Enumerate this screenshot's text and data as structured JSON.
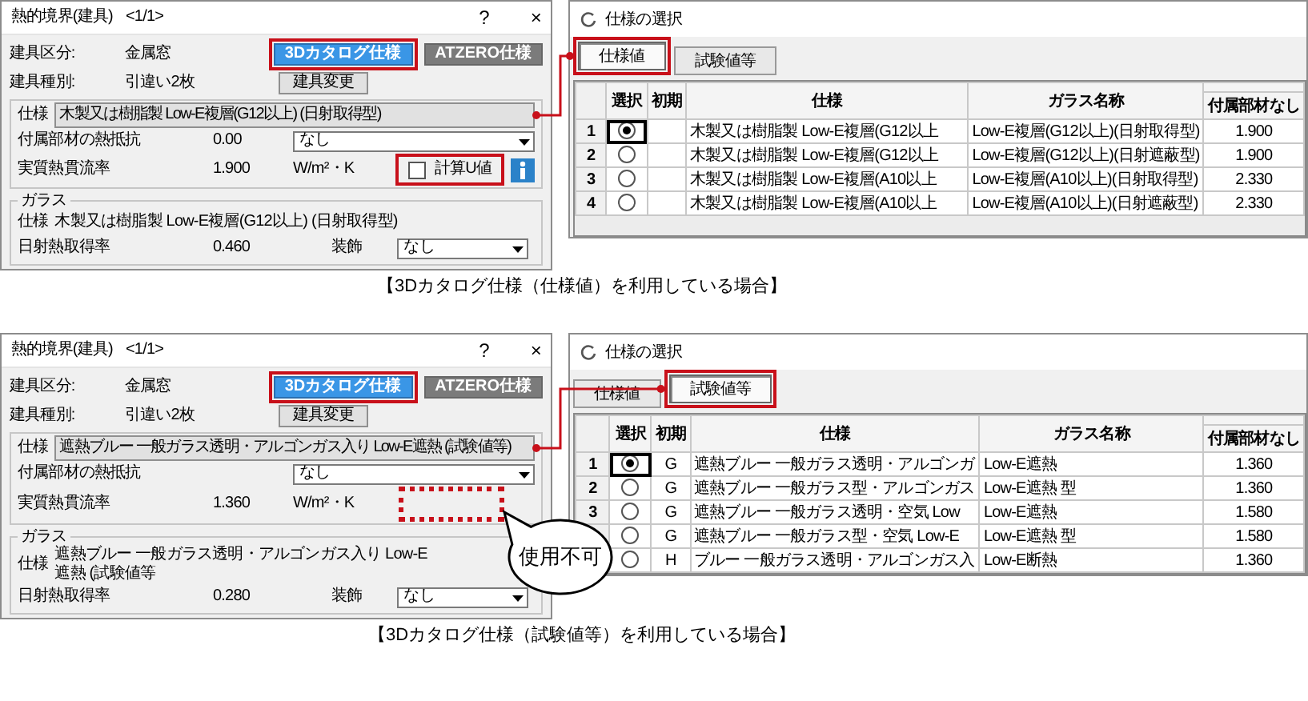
{
  "panels": [
    {
      "spec_dialog": {
        "title": "熱的境界(建具)",
        "page": "<1/1>",
        "help_button": "?",
        "close_button": "×",
        "class_label": "建具区分:",
        "class_value": "金属窓",
        "type_label": "建具種別:",
        "type_value": "引違い2枚",
        "mode_buttons": [
          {
            "label": "3Dカタログ仕様",
            "selected": true,
            "highlighted": true
          },
          {
            "label": "ATZERO仕様",
            "selected": false,
            "highlighted": false
          }
        ],
        "change_button": "建具変更",
        "spec_label": "仕様",
        "spec_value": "木製又は樹脂製 Low-E複層(G12以上) (日射取得型)",
        "resistance_label": "付属部材の熱抵抗",
        "resistance_value": "0.00",
        "resistance_select": "なし",
        "u_label": "実質熱貫流率",
        "u_value": "1.900",
        "u_unit": "W/m²・K",
        "calc_u": {
          "kind": "checkbox",
          "label": "計算U値",
          "checked": false,
          "highlighted": true
        },
        "info_button": true,
        "glass_group": "ガラス",
        "glass_spec_label": "仕様",
        "glass_spec_value": "木製又は樹脂製 Low-E複層(G12以上) (日射取得型)",
        "solar_label": "日射熱取得率",
        "solar_value": "0.460",
        "decoration_label": "装飾",
        "decoration_select": "なし"
      },
      "selection_dialog": {
        "title": "仕様の選択",
        "tabs": [
          {
            "label": "仕様値",
            "selected": true,
            "highlighted": true
          },
          {
            "label": "試験値等",
            "selected": false,
            "highlighted": false
          }
        ],
        "columns": [
          "選択",
          "初期",
          "仕様",
          "ガラス名称",
          "付属部材なし"
        ],
        "rows": [
          {
            "number": "1",
            "selected": true,
            "spec": "木製又は樹脂製 Low-E複層(G12以上",
            "glass": "Low-E複層(G12以上)(日射取得型)",
            "value": "1.900"
          },
          {
            "number": "2",
            "selected": false,
            "spec": "木製又は樹脂製 Low-E複層(G12以上",
            "glass": "Low-E複層(G12以上)(日射遮蔽型)",
            "value": "1.900"
          },
          {
            "number": "3",
            "selected": false,
            "spec": "木製又は樹脂製 Low-E複層(A10以上",
            "glass": "Low-E複層(A10以上)(日射取得型)",
            "value": "2.330"
          },
          {
            "number": "4",
            "selected": false,
            "spec": "木製又は樹脂製 Low-E複層(A10以上",
            "glass": "Low-E複層(A10以上)(日射遮蔽型)",
            "value": "2.330"
          }
        ]
      },
      "caption": "【3Dカタログ仕様（仕様値）を利用している場合】"
    },
    {
      "spec_dialog": {
        "title": "熱的境界(建具)",
        "page": "<1/1>",
        "help_button": "?",
        "close_button": "×",
        "class_label": "建具区分:",
        "class_value": "金属窓",
        "type_label": "建具種別:",
        "type_value": "引違い2枚",
        "mode_buttons": [
          {
            "label": "3Dカタログ仕様",
            "selected": true,
            "highlighted": true
          },
          {
            "label": "ATZERO仕様",
            "selected": false,
            "highlighted": false
          }
        ],
        "change_button": "建具変更",
        "spec_label": "仕様",
        "spec_value": "遮熱ブルー 一般ガラス透明・アルゴンガス入り Low-E遮熱 (試験値等)",
        "resistance_label": "付属部材の熱抵抗",
        "resistance_select": "なし",
        "u_label": "実質熱貫流率",
        "u_value": "1.360",
        "u_unit": "W/m²・K",
        "calc_u": {
          "kind": "unavailable"
        },
        "info_button": false,
        "glass_group": "ガラス",
        "glass_spec_label": "仕様",
        "glass_spec_value": "遮熱ブルー 一般ガラス透明・アルゴンガス入り Low-E遮熱 (試験値等",
        "solar_label": "日射熱取得率",
        "solar_value": "0.280",
        "decoration_label": "装飾",
        "decoration_select": "なし"
      },
      "selection_dialog": {
        "title": "仕様の選択",
        "tabs": [
          {
            "label": "仕様値",
            "selected": false,
            "highlighted": false
          },
          {
            "label": "試験値等",
            "selected": true,
            "highlighted": true
          }
        ],
        "columns": [
          "選択",
          "初期",
          "仕様",
          "ガラス名称",
          "付属部材なし"
        ],
        "rows": [
          {
            "number": "1",
            "selected": true,
            "initial": "G",
            "spec": "遮熱ブルー 一般ガラス透明・アルゴンガ",
            "glass": "Low-E遮熱",
            "value": "1.360"
          },
          {
            "number": "2",
            "selected": false,
            "initial": "G",
            "spec": "遮熱ブルー 一般ガラス型・アルゴンガス",
            "glass": "Low-E遮熱 型",
            "value": "1.360"
          },
          {
            "number": "3",
            "selected": false,
            "initial": "G",
            "spec": "遮熱ブルー 一般ガラス透明・空気 Low",
            "glass": "Low-E遮熱",
            "value": "1.580"
          },
          {
            "selected": false,
            "initial": "G",
            "spec": "遮熱ブルー 一般ガラス型・空気 Low-E",
            "glass": "Low-E遮熱 型",
            "value": "1.580"
          },
          {
            "selected": false,
            "initial": "H",
            "spec": "ブルー 一般ガラス透明・アルゴンガス入",
            "glass": "Low-E断熱",
            "value": "1.360"
          }
        ]
      },
      "caption": "【3Dカタログ仕様（試験値等）を利用している場合】",
      "callout": "使用不可"
    }
  ]
}
